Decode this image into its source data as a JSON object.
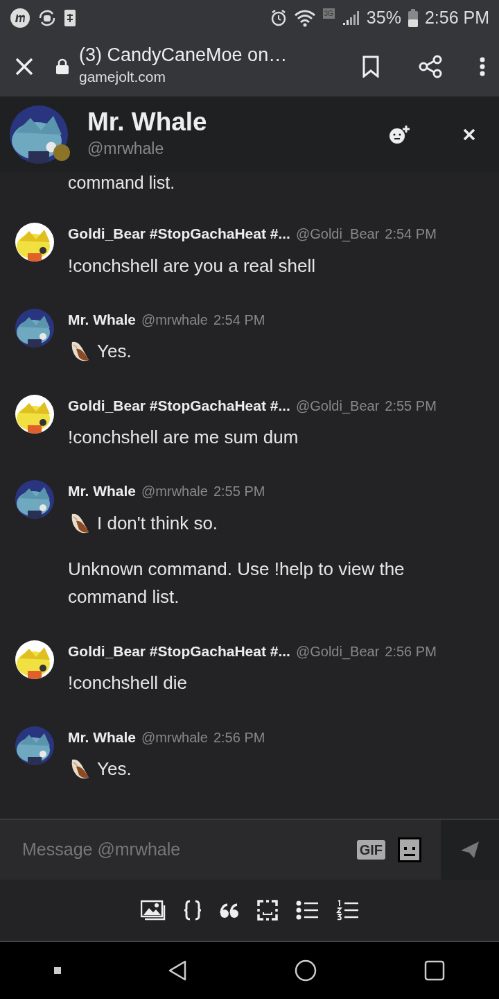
{
  "status_bar": {
    "network": "3G",
    "battery": "35%",
    "time": "2:56 PM"
  },
  "browser": {
    "title": "(3) CandyCaneMoe on…",
    "url": "gamejolt.com"
  },
  "chat_header": {
    "name": "Mr. Whale",
    "handle": "@mrwhale",
    "color": "#8b7428"
  },
  "overflow_text": "command list.",
  "messages": [
    {
      "name": "Goldi_Bear #StopGachaHeat #...",
      "handle": "@Goldi_Bear",
      "time": "2:54 PM",
      "lines": [
        {
          "kind": "plain",
          "text": "!conchshell are you a real shell"
        }
      ]
    },
    {
      "name": "Mr. Whale",
      "handle": "@mrwhale",
      "time": "2:54 PM",
      "lines": [
        {
          "kind": "shell",
          "text": "Yes."
        }
      ]
    },
    {
      "name": "Goldi_Bear #StopGachaHeat #...",
      "handle": "@Goldi_Bear",
      "time": "2:55 PM",
      "lines": [
        {
          "kind": "plain",
          "text": "!conchshell are me sum dum"
        }
      ]
    },
    {
      "name": "Mr. Whale",
      "handle": "@mrwhale",
      "time": "2:55 PM",
      "lines": [
        {
          "kind": "shell",
          "text": "I don't think so."
        },
        {
          "kind": "plain",
          "text": "Unknown command. Use !help to view the command list."
        }
      ]
    },
    {
      "name": "Goldi_Bear #StopGachaHeat #...",
      "handle": "@Goldi_Bear",
      "time": "2:56 PM",
      "lines": [
        {
          "kind": "plain",
          "text": "!conchshell die"
        }
      ]
    },
    {
      "name": "Mr. Whale",
      "handle": "@mrwhale",
      "time": "2:56 PM",
      "lines": [
        {
          "kind": "shell",
          "text": "Yes."
        }
      ]
    }
  ],
  "composer": {
    "placeholder": "Message @mrwhale",
    "gif": "GIF"
  }
}
